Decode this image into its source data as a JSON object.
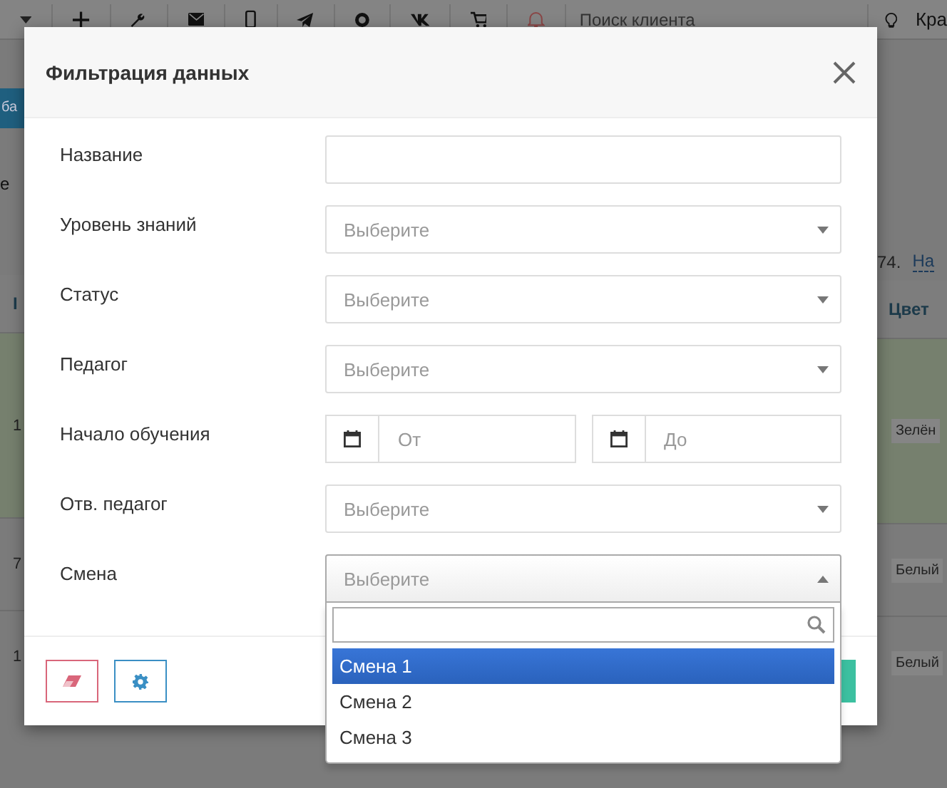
{
  "toolbar": {
    "search_placeholder": "Поиск клиента",
    "user_label": "Кра"
  },
  "page": {
    "add_button": "ба",
    "left_text": "е",
    "id_header": "I",
    "count": "74.",
    "link": "На",
    "color_header": "Цвет",
    "rows": [
      {
        "number": "1",
        "color_label": "Зелён",
        "highlighted": true
      },
      {
        "number": "7",
        "color_label": "Белый",
        "highlighted": false
      },
      {
        "number": "1",
        "color_label": "Белый",
        "highlighted": false
      }
    ]
  },
  "modal": {
    "title": "Фильтрация данных",
    "fields": [
      {
        "label": "Название",
        "kind": "text"
      },
      {
        "label": "Уровень знаний",
        "kind": "select",
        "placeholder": "Выберите",
        "open": false
      },
      {
        "label": "Статус",
        "kind": "select",
        "placeholder": "Выберите",
        "open": false
      },
      {
        "label": "Педагог",
        "kind": "select",
        "placeholder": "Выберите",
        "open": false
      },
      {
        "label": "Начало обучения",
        "kind": "date_range",
        "from_placeholder": "От",
        "to_placeholder": "До"
      },
      {
        "label": "Отв. педагог",
        "kind": "select",
        "placeholder": "Выберите",
        "open": false
      },
      {
        "label": "Смена",
        "kind": "select",
        "placeholder": "Выберите",
        "open": true,
        "options": [
          {
            "label": "Смена 1",
            "selected": true
          },
          {
            "label": "Смена 2",
            "selected": false
          },
          {
            "label": "Смена 3",
            "selected": false
          }
        ]
      }
    ],
    "footer_buttons": [
      {
        "kind": "clear"
      },
      {
        "kind": "settings"
      },
      {
        "kind": "submit"
      }
    ]
  }
}
